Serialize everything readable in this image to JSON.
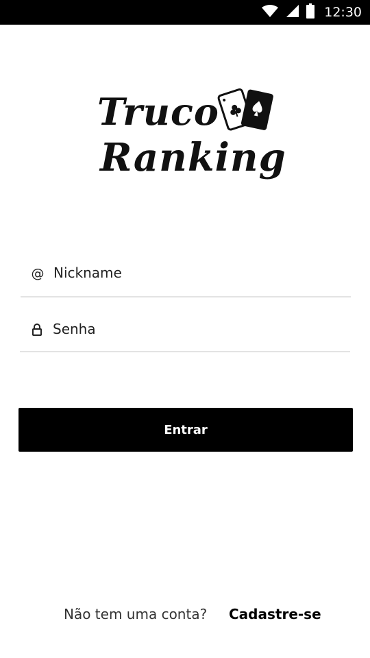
{
  "status_bar": {
    "time": "12:30",
    "icons": [
      "wifi-icon",
      "signal-icon",
      "battery-icon"
    ]
  },
  "logo": {
    "line1": "Truco",
    "line2": "Ranking"
  },
  "login_form": {
    "nickname": {
      "placeholder": "Nickname",
      "value": "",
      "icon": "at-icon"
    },
    "password": {
      "placeholder": "Senha",
      "value": "",
      "icon": "lock-icon"
    },
    "submit_label": "Entrar"
  },
  "footer": {
    "question": "Não tem uma conta?",
    "signup_label": "Cadastre-se"
  },
  "colors": {
    "status_bar_bg": "#000000",
    "button_bg": "#000000",
    "button_text": "#ffffff",
    "divider": "#e3e3e3",
    "background": "#ffffff"
  }
}
